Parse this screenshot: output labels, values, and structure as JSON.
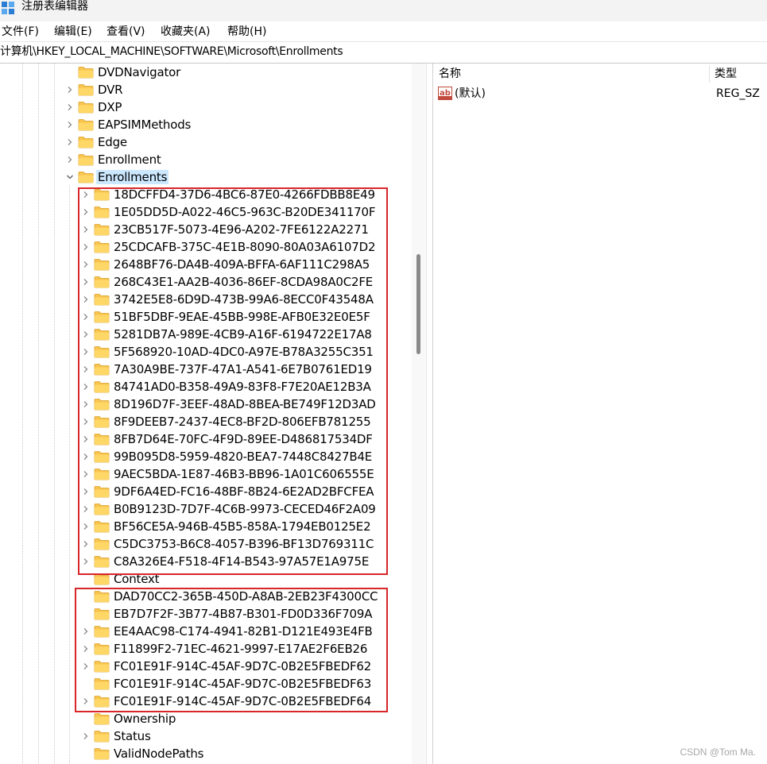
{
  "window": {
    "title": "注册表编辑器"
  },
  "menu": {
    "items": [
      "文件(F)",
      "编辑(E)",
      "查看(V)",
      "收藏夹(A)",
      "帮助(H)"
    ]
  },
  "address": {
    "path": "计算机\\HKEY_LOCAL_MACHINE\\SOFTWARE\\Microsoft\\Enrollments"
  },
  "tree": {
    "items": [
      {
        "label": "DVDNavigator",
        "expander": "none"
      },
      {
        "label": "DVR",
        "expander": "collapsed"
      },
      {
        "label": "DXP",
        "expander": "collapsed"
      },
      {
        "label": "EAPSIMMethods",
        "expander": "collapsed"
      },
      {
        "label": "Edge",
        "expander": "collapsed"
      },
      {
        "label": "Enrollment",
        "expander": "collapsed"
      },
      {
        "label": "Enrollments",
        "expander": "expanded",
        "selected": true
      }
    ],
    "children": [
      {
        "label": "18DCFFD4-37D6-4BC6-87E0-4266FDBB8E49",
        "expander": "collapsed"
      },
      {
        "label": "1E05DD5D-A022-46C5-963C-B20DE341170F",
        "expander": "collapsed"
      },
      {
        "label": "23CB517F-5073-4E96-A202-7FE6122A2271",
        "expander": "collapsed"
      },
      {
        "label": "25CDCAFB-375C-4E1B-8090-80A03A6107D2",
        "expander": "collapsed"
      },
      {
        "label": "2648BF76-DA4B-409A-BFFA-6AF111C298A5",
        "expander": "collapsed"
      },
      {
        "label": "268C43E1-AA2B-4036-86EF-8CDA98A0C2FE",
        "expander": "collapsed"
      },
      {
        "label": "3742E5E8-6D9D-473B-99A6-8ECC0F43548A",
        "expander": "collapsed"
      },
      {
        "label": "51BF5DBF-9EAE-45BB-998E-AFB0E32E0E5F",
        "expander": "collapsed"
      },
      {
        "label": "5281DB7A-989E-4CB9-A16F-6194722E17A8",
        "expander": "collapsed"
      },
      {
        "label": "5F568920-10AD-4DC0-A97E-B78A3255C351",
        "expander": "collapsed"
      },
      {
        "label": "7A30A9BE-737F-47A1-A541-6E7B0761ED19",
        "expander": "collapsed"
      },
      {
        "label": "84741AD0-B358-49A9-83F8-F7E20AE12B3A",
        "expander": "collapsed"
      },
      {
        "label": "8D196D7F-3EEF-48AD-8BEA-BE749F12D3AD",
        "expander": "collapsed"
      },
      {
        "label": "8F9DEEB7-2437-4EC8-BF2D-806EFB781255",
        "expander": "collapsed"
      },
      {
        "label": "8FB7D64E-70FC-4F9D-89EE-D486817534DF",
        "expander": "collapsed"
      },
      {
        "label": "99B095D8-5959-4820-BEA7-7448C8427B4E",
        "expander": "collapsed"
      },
      {
        "label": "9AEC5BDA-1E87-46B3-BB96-1A01C606555E",
        "expander": "collapsed"
      },
      {
        "label": "9DF6A4ED-FC16-48BF-8B24-6E2AD2BFCFEA",
        "expander": "collapsed"
      },
      {
        "label": "B0B9123D-7D7F-4C6B-9973-CECED46F2A09",
        "expander": "collapsed"
      },
      {
        "label": "BF56CE5A-946B-45B5-858A-1794EB0125E2",
        "expander": "collapsed"
      },
      {
        "label": "C5DC3753-B6C8-4057-B396-BF13D769311C",
        "expander": "collapsed"
      },
      {
        "label": "C8A326E4-F518-4F14-B543-97A57E1A975E",
        "expander": "collapsed"
      },
      {
        "label": "Context",
        "expander": "none"
      },
      {
        "label": "DAD70CC2-365B-450D-A8AB-2EB23F4300CC",
        "expander": "none"
      },
      {
        "label": "EB7D7F2F-3B77-4B87-B301-FD0D336F709A",
        "expander": "none"
      },
      {
        "label": "EE4AAC98-C174-4941-82B1-D121E493E4FB",
        "expander": "collapsed"
      },
      {
        "label": "F11899F2-71EC-4621-9997-E17AE2F6EB26",
        "expander": "collapsed"
      },
      {
        "label": "FC01E91F-914C-45AF-9D7C-0B2E5FBEDF62",
        "expander": "collapsed"
      },
      {
        "label": "FC01E91F-914C-45AF-9D7C-0B2E5FBEDF63",
        "expander": "none"
      },
      {
        "label": "FC01E91F-914C-45AF-9D7C-0B2E5FBEDF64",
        "expander": "collapsed"
      },
      {
        "label": "Ownership",
        "expander": "none"
      },
      {
        "label": "Status",
        "expander": "collapsed"
      },
      {
        "label": "ValidNodePaths",
        "expander": "none"
      }
    ]
  },
  "values": {
    "columns": {
      "name": "名称",
      "type": "类型"
    },
    "rows": [
      {
        "name": "(默认)",
        "type": "REG_SZ",
        "icon": "string-value-icon"
      }
    ]
  },
  "colors": {
    "highlight_box": "#d9262b",
    "selection": "#cce8ff",
    "folder": "#f8c44f"
  },
  "watermark": "CSDN @Tom Ma."
}
